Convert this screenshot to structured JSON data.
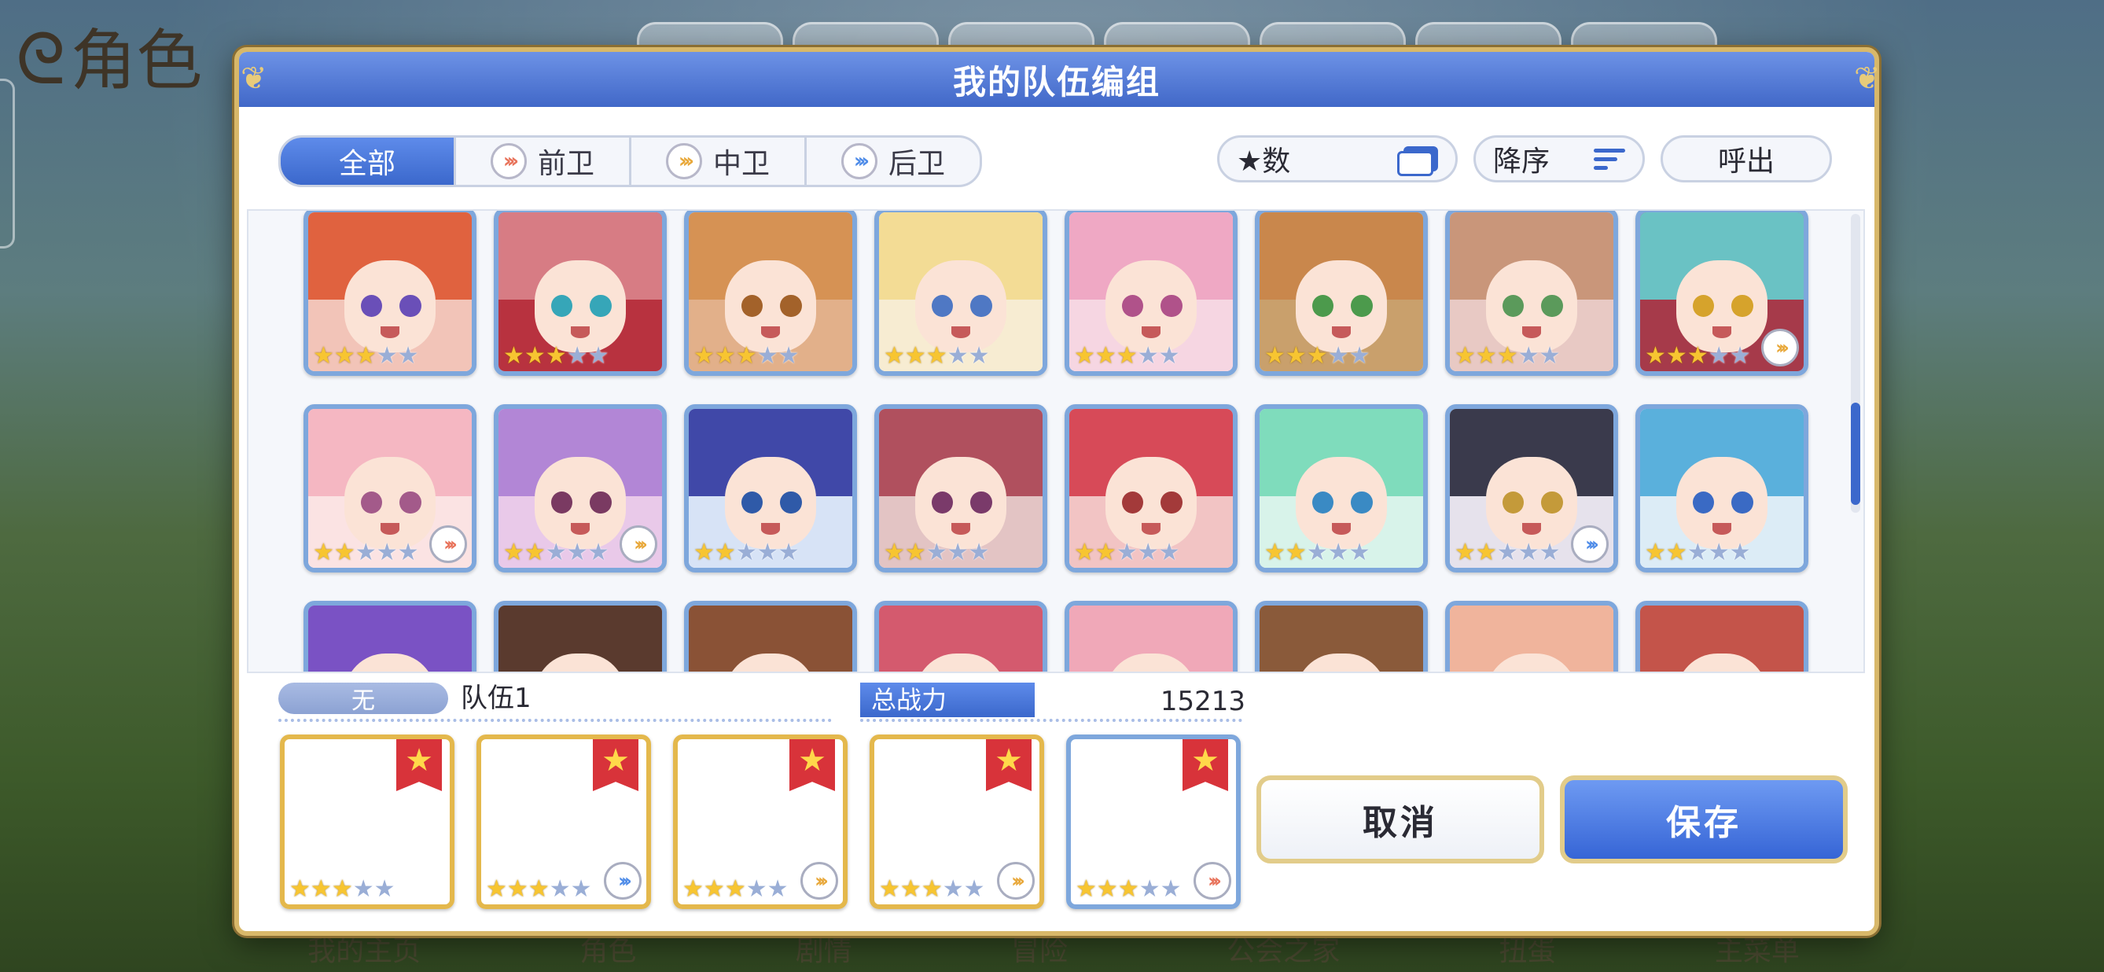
{
  "background": {
    "title": "角色",
    "bottom_nav": [
      "我的主页",
      "角色",
      "剧情",
      "冒险",
      "公会之家",
      "扭蛋",
      "主菜单"
    ]
  },
  "dialog": {
    "title": "我的队伍编组"
  },
  "filter_tabs": [
    {
      "label": "全部",
      "icon": "none",
      "active": true
    },
    {
      "label": "前卫",
      "icon": "front-position-icon",
      "active": false
    },
    {
      "label": "中卫",
      "icon": "mid-position-icon",
      "active": false
    },
    {
      "label": "后卫",
      "icon": "back-position-icon",
      "active": false
    }
  ],
  "controls": {
    "sort_label": "★数",
    "order_label": "降序",
    "call_label": "呼出"
  },
  "roster": [
    {
      "stars": 3,
      "position": "none",
      "palette": {
        "hair": "#e0623f",
        "eye": "#6a4fb8",
        "bg": "#f2c4b8"
      }
    },
    {
      "stars": 3,
      "position": "none",
      "palette": {
        "hair": "#d77c84",
        "eye": "#36a6b8",
        "bg": "#b8323f"
      }
    },
    {
      "stars": 3,
      "position": "none",
      "palette": {
        "hair": "#d69254",
        "eye": "#a3622a",
        "bg": "#e2b08a"
      }
    },
    {
      "stars": 3,
      "position": "none",
      "palette": {
        "hair": "#f3dc95",
        "eye": "#4f78c4",
        "bg": "#f7ecd2"
      }
    },
    {
      "stars": 3,
      "position": "none",
      "palette": {
        "hair": "#efa8c4",
        "eye": "#b0528a",
        "bg": "#f6d6e2"
      }
    },
    {
      "stars": 3,
      "position": "none",
      "palette": {
        "hair": "#c9874c",
        "eye": "#4c9a4c",
        "bg": "#c9a06c"
      }
    },
    {
      "stars": 3,
      "position": "none",
      "palette": {
        "hair": "#c9967a",
        "eye": "#5b9a5b",
        "bg": "#e8c9c4"
      }
    },
    {
      "stars": 3,
      "position": "mid",
      "palette": {
        "hair": "#6ac2c4",
        "eye": "#d6a32c",
        "bg": "#a63a4a"
      }
    },
    {
      "stars": 2,
      "position": "front",
      "palette": {
        "hair": "#f5b7c2",
        "eye": "#a35a8a",
        "bg": "#fbe3e3"
      }
    },
    {
      "stars": 2,
      "position": "mid",
      "palette": {
        "hair": "#b286d6",
        "eye": "#7a3a62",
        "bg": "#e9c9e9"
      }
    },
    {
      "stars": 2,
      "position": "none",
      "palette": {
        "hair": "#4048a8",
        "eye": "#2f5aa8",
        "bg": "#d7e3f6"
      }
    },
    {
      "stars": 2,
      "position": "none",
      "palette": {
        "hair": "#b0505e",
        "eye": "#7a3a6a",
        "bg": "#e3c4c4"
      }
    },
    {
      "stars": 2,
      "position": "none",
      "palette": {
        "hair": "#d74a58",
        "eye": "#a33a3a",
        "bg": "#f2c4c4"
      }
    },
    {
      "stars": 2,
      "position": "none",
      "palette": {
        "hair": "#7fdcbc",
        "eye": "#3a8ac4",
        "bg": "#d8f3ea"
      }
    },
    {
      "stars": 2,
      "position": "back",
      "palette": {
        "hair": "#3a3a4c",
        "eye": "#c49a3a",
        "bg": "#e6e2ec"
      }
    },
    {
      "stars": 2,
      "position": "none",
      "palette": {
        "hair": "#5ab0dc",
        "eye": "#3a6ac4",
        "bg": "#dcecf6"
      }
    },
    {
      "stars": 0,
      "position": "none",
      "palette": {
        "hair": "#7a52c4",
        "eye": "#7a52c4",
        "bg": "#bda6e2"
      }
    },
    {
      "stars": 0,
      "position": "none",
      "palette": {
        "hair": "#5a3a2e",
        "eye": "#5a3a2e",
        "bg": "#c9b8a8"
      }
    },
    {
      "stars": 0,
      "position": "none",
      "palette": {
        "hair": "#8a5236",
        "eye": "#8a5236",
        "bg": "#e0b0a0"
      }
    },
    {
      "stars": 0,
      "position": "none",
      "palette": {
        "hair": "#d45a6e",
        "eye": "#d45a6e",
        "bg": "#f0c0c8"
      }
    },
    {
      "stars": 0,
      "position": "none",
      "palette": {
        "hair": "#f0a8b8",
        "eye": "#f0a8b8",
        "bg": "#fbe0e6"
      }
    },
    {
      "stars": 0,
      "position": "none",
      "palette": {
        "hair": "#8a5a3a",
        "eye": "#8a5a3a",
        "bg": "#d8b8a0"
      }
    },
    {
      "stars": 0,
      "position": "none",
      "palette": {
        "hair": "#f0b49c",
        "eye": "#f0b49c",
        "bg": "#fbe0d4"
      }
    },
    {
      "stars": 0,
      "position": "none",
      "palette": {
        "hair": "#c4544a",
        "eye": "#c4544a",
        "bg": "#6cc4b0"
      }
    }
  ],
  "team": {
    "status_label": "无",
    "name": "队伍1",
    "power_label": "总战力",
    "power_value": "15213"
  },
  "party": [
    {
      "stars": 3,
      "position": "none",
      "frame": "gold",
      "palette": {
        "hair": "#34343e",
        "eye": "#5aa05a",
        "bg": "#ecd7cc"
      }
    },
    {
      "stars": 3,
      "position": "back",
      "frame": "gold",
      "palette": {
        "hair": "#d45aa8",
        "eye": "#b04060",
        "bg": "#f3c9e4"
      }
    },
    {
      "stars": 3,
      "position": "mid",
      "frame": "gold",
      "palette": {
        "hair": "#f2d078",
        "eye": "#3a6ac4",
        "bg": "#f7ecd2"
      }
    },
    {
      "stars": 3,
      "position": "mid",
      "frame": "gold",
      "palette": {
        "hair": "#ece6ea",
        "eye": "#c43a4a",
        "bg": "#e6f0d4"
      }
    },
    {
      "stars": 3,
      "position": "front",
      "frame": "blue",
      "palette": {
        "hair": "#c44a4a",
        "eye": "#a03a5a",
        "bg": "#5a2a4a"
      }
    }
  ],
  "buttons": {
    "cancel": "取消",
    "save": "保存"
  },
  "colors": {
    "accent": "#3b68cc",
    "gold_frame": "#e4b84c",
    "blue_frame": "#7ea7dc",
    "star_on": "#f7c531",
    "star_off": "#9aaed6"
  }
}
